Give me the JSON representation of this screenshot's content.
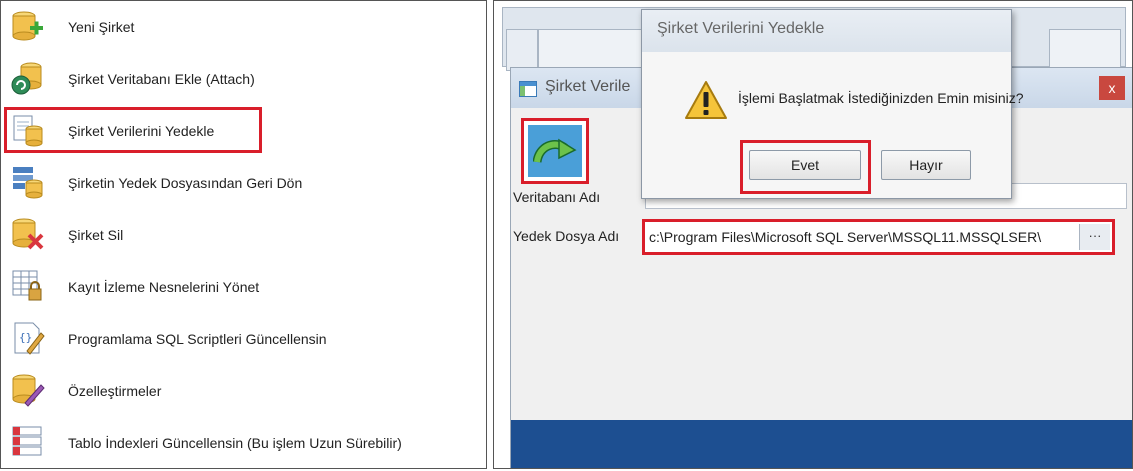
{
  "menu": {
    "items": [
      {
        "label": "Yeni Şirket",
        "icon": "database-add-icon"
      },
      {
        "label": "Şirket Veritabanı Ekle (Attach)",
        "icon": "database-attach-icon"
      },
      {
        "label": "Şirket Verilerini Yedekle",
        "icon": "database-backup-icon"
      },
      {
        "label": "Şirketin Yedek Dosyasından Geri Dön",
        "icon": "database-restore-icon"
      },
      {
        "label": "Şirket Sil",
        "icon": "database-delete-icon"
      },
      {
        "label": "Kayıt İzleme Nesnelerini Yönet",
        "icon": "table-lock-icon"
      },
      {
        "label": "Programlama SQL Scriptleri Güncellensin",
        "icon": "script-edit-icon"
      },
      {
        "label": "Özelleştirmeler",
        "icon": "database-edit-icon"
      },
      {
        "label": "Tablo İndexleri Güncellensin (Bu işlem Uzun Sürebilir)",
        "icon": "numbered-list-icon"
      }
    ]
  },
  "window": {
    "title": "Şirket Verile",
    "close_label": "x",
    "db_label": "Veritabanı Adı",
    "db_value": "",
    "backup_label": "Yedek Dosya Adı",
    "backup_value": "c:\\Program Files\\Microsoft SQL Server\\MSSQL11.MSSQLSER\\",
    "browse_label": "···"
  },
  "dialog": {
    "title": "Şirket Verilerini Yedekle",
    "message": "İşlemi Başlatmak İstediğinizden Emin misiniz?",
    "yes_label": "Evet",
    "no_label": "Hayır"
  },
  "colors": {
    "highlight": "#d91e2a",
    "status_bar": "#1d4f91",
    "run_button": "#4a9fd8"
  }
}
